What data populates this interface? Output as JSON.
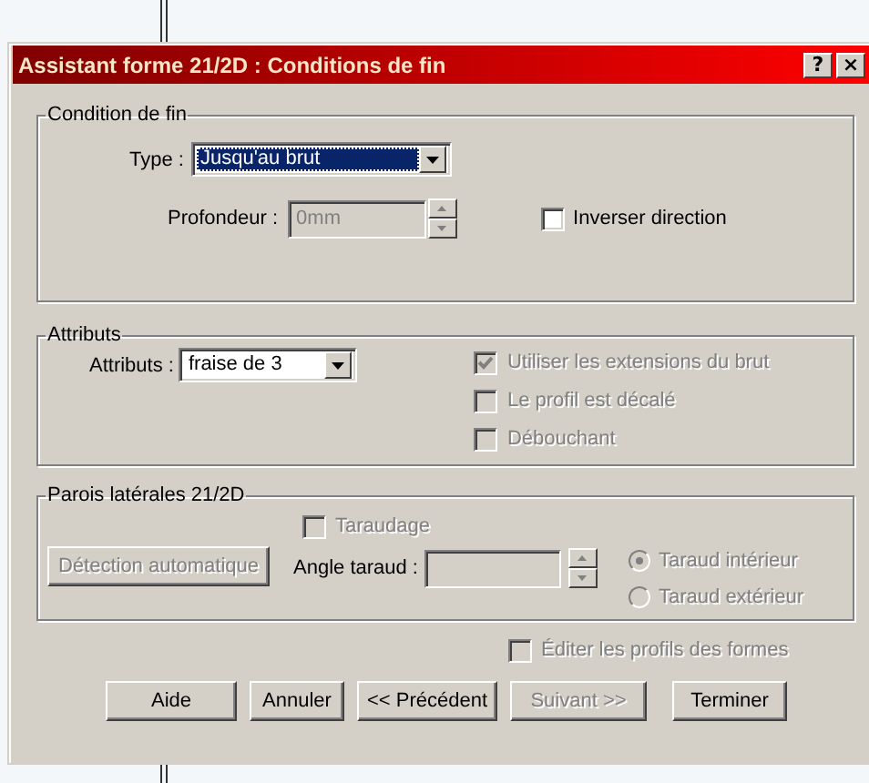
{
  "dialog": {
    "title": "Assistant forme 21/2D : Conditions de fin",
    "title_buttons": [
      "?",
      "×"
    ]
  },
  "end_condition": {
    "title": "Condition de fin",
    "type": {
      "label": "Type :",
      "value": "Jusqu'au brut",
      "highlighted": true
    },
    "depth": {
      "label": "Profondeur :",
      "value": "0mm",
      "disabled": true
    },
    "reverse": {
      "label": "Inverser direction",
      "checked": false,
      "disabled": false
    }
  },
  "attributes": {
    "title": "Attributs",
    "attributes": {
      "label": "Attributs :",
      "value": "fraise de 3",
      "highlighted": false
    },
    "options": [
      {
        "label": "Utiliser les extensions du brut",
        "checked": true,
        "disabled": true
      },
      {
        "label": "Le profil est décalé",
        "checked": false,
        "disabled": true
      },
      {
        "label": "Débouchant",
        "checked": false,
        "disabled": true
      }
    ]
  },
  "side_walls": {
    "title": "Parois latérales 21/2D",
    "tapping": {
      "label": "Taraudage",
      "checked": false,
      "disabled": true
    },
    "auto_detect": {
      "label": "Détection automatique",
      "disabled": true
    },
    "tap_angle": {
      "label": "Angle taraud :",
      "disabled": true
    },
    "tap_types": [
      {
        "label": "Taraud intérieur",
        "selected": true,
        "disabled": true
      },
      {
        "label": "Taraud extérieur",
        "selected": false,
        "disabled": true
      }
    ]
  },
  "edit_profiles": {
    "label": "Éditer les profils des formes",
    "checked": false,
    "disabled": true
  },
  "buttons": [
    {
      "label": "Aide",
      "disabled": false
    },
    {
      "label": "Annuler",
      "disabled": false
    },
    {
      "label": "<< Précédent",
      "disabled": false
    },
    {
      "label": "Suivant >>",
      "disabled": true
    },
    {
      "label": "Terminer",
      "disabled": false
    }
  ]
}
